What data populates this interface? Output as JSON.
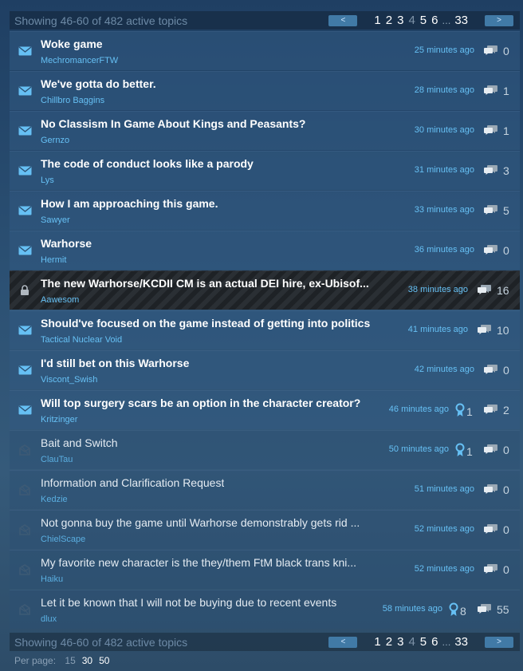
{
  "pager": {
    "showing": "Showing 46-60 of 482 active topics",
    "prev_label": "<",
    "next_label": ">",
    "pages": [
      "1",
      "2",
      "3",
      "4",
      "5",
      "6"
    ],
    "ellipsis": "...",
    "last_page": "33",
    "current_page": "4"
  },
  "topics": [
    {
      "title": "Woke game",
      "author": "MechromancerFTW",
      "time": "25 minutes ago",
      "replies": "0",
      "awards": "",
      "state": "unread"
    },
    {
      "title": "We've gotta do better.",
      "author": "Chillbro Baggins",
      "time": "28 minutes ago",
      "replies": "1",
      "awards": "",
      "state": "unread"
    },
    {
      "title": "No Classism In Game About Kings and Peasants?",
      "author": "Gernzo",
      "time": "30 minutes ago",
      "replies": "1",
      "awards": "",
      "state": "unread"
    },
    {
      "title": "The code of conduct looks like a parody",
      "author": "Lys",
      "time": "31 minutes ago",
      "replies": "3",
      "awards": "",
      "state": "unread"
    },
    {
      "title": "How I am approaching this game.",
      "author": "Sawyer",
      "time": "33 minutes ago",
      "replies": "5",
      "awards": "",
      "state": "unread"
    },
    {
      "title": "Warhorse",
      "author": "Hermit",
      "time": "36 minutes ago",
      "replies": "0",
      "awards": "",
      "state": "unread"
    },
    {
      "title": "The new Warhorse/KCDII CM is an actual DEI hire, ex-Ubisof...",
      "author": "Aawesom",
      "time": "38 minutes ago",
      "replies": "16",
      "awards": "",
      "state": "locked"
    },
    {
      "title": "Should've focused on the game instead of getting into politics",
      "author": "Tactical Nuclear Void",
      "time": "41 minutes ago",
      "replies": "10",
      "awards": "",
      "state": "unread"
    },
    {
      "title": "I'd still bet on this Warhorse",
      "author": "Viscont_Swish",
      "time": "42 minutes ago",
      "replies": "0",
      "awards": "",
      "state": "unread"
    },
    {
      "title": "Will top surgery scars be an option in the character creator?",
      "author": "Kritzinger",
      "time": "46 minutes ago",
      "replies": "2",
      "awards": "1",
      "state": "unread"
    },
    {
      "title": "Bait and Switch",
      "author": "ClauTau",
      "time": "50 minutes ago",
      "replies": "0",
      "awards": "1",
      "state": "read"
    },
    {
      "title": "Information and Clarification Request",
      "author": "Kedzie",
      "time": "51 minutes ago",
      "replies": "0",
      "awards": "",
      "state": "read"
    },
    {
      "title": "Not gonna buy the game until Warhorse demonstrably gets rid ...",
      "author": "ChielScape",
      "time": "52 minutes ago",
      "replies": "0",
      "awards": "",
      "state": "read"
    },
    {
      "title": "My favorite new character is the they/them FtM black trans kni...",
      "author": "Haiku",
      "time": "52 minutes ago",
      "replies": "0",
      "awards": "",
      "state": "read"
    },
    {
      "title": "Let it be known that I will not be buying due to recent events",
      "author": "dlux",
      "time": "58 minutes ago",
      "replies": "55",
      "awards": "8",
      "state": "read"
    }
  ],
  "per_page": {
    "label": "Per page:",
    "options": [
      "15",
      "30",
      "50"
    ],
    "selected": "15"
  },
  "colors": {
    "accent": "#66c0f4",
    "button": "#417aa6",
    "background": "#2b5073"
  },
  "icons": {
    "unread": "envelope-icon",
    "locked": "lock-icon",
    "read": "read-topic-icon",
    "award": "award-ribbon-icon",
    "replies": "speech-bubbles-icon"
  }
}
